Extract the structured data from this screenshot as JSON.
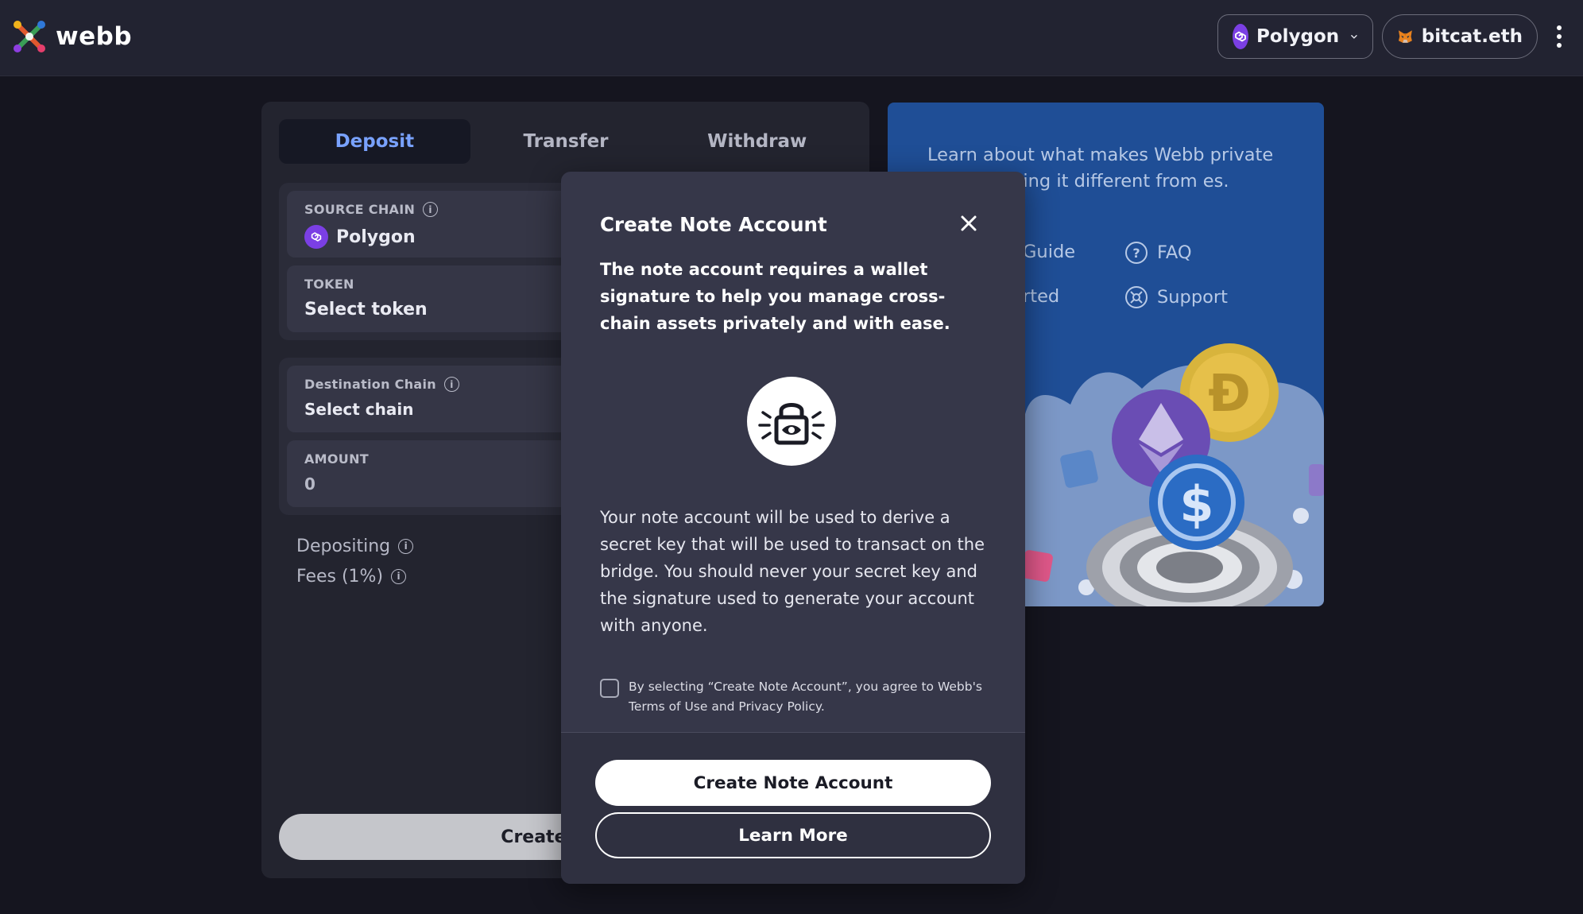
{
  "brand": {
    "name": "webb"
  },
  "header": {
    "chain_selector": {
      "label": "Polygon",
      "icon": "polygon-icon"
    },
    "wallet": {
      "label": "bitcat.eth",
      "icon": "metamask-fox-icon"
    },
    "more_menu_icon": "kebab-icon"
  },
  "tabs": [
    {
      "label": "Deposit",
      "active": true
    },
    {
      "label": "Transfer",
      "active": false
    },
    {
      "label": "Withdraw",
      "active": false
    }
  ],
  "form": {
    "source_chain": {
      "label": "SOURCE CHAIN",
      "value": "Polygon"
    },
    "token": {
      "label": "TOKEN",
      "value": "Select token"
    },
    "destination_chain": {
      "label": "Destination Chain",
      "value": "Select chain"
    },
    "amount": {
      "label": "AMOUNT",
      "value": "0"
    },
    "depositing_label": "Depositing",
    "fees_label": "Fees (1%)",
    "submit_label": "Create No"
  },
  "info_panel": {
    "text": "Learn about what makes Webb private and kes using it different from es.",
    "links": [
      {
        "label": "Guide",
        "icon": "book-icon"
      },
      {
        "label": "FAQ",
        "icon": "question-icon"
      },
      {
        "label": "rted",
        "icon": "rocket-icon"
      },
      {
        "label": "Support",
        "icon": "lifebuoy-icon"
      }
    ]
  },
  "modal": {
    "title": "Create Note Account",
    "lead": "The note account requires a wallet signature to help you manage cross-chain assets privately and with ease.",
    "body": "Your note account will be used to derive a secret key that will be used to transact on the bridge. You should never your secret key and the signature used to generate your account with anyone.",
    "consent": "By selecting “Create Note Account”, you agree to Webb's Terms of Use and Privacy Policy.",
    "primary_button": "Create Note Account",
    "secondary_button": "Learn More"
  },
  "colors": {
    "background": "#15151f",
    "topbar": "#222331",
    "card": "#23242f",
    "accent_tab": "#79a2ff",
    "info_panel": "#1f4e96",
    "modal": "#363749",
    "polygon": "#7b3fe4"
  }
}
